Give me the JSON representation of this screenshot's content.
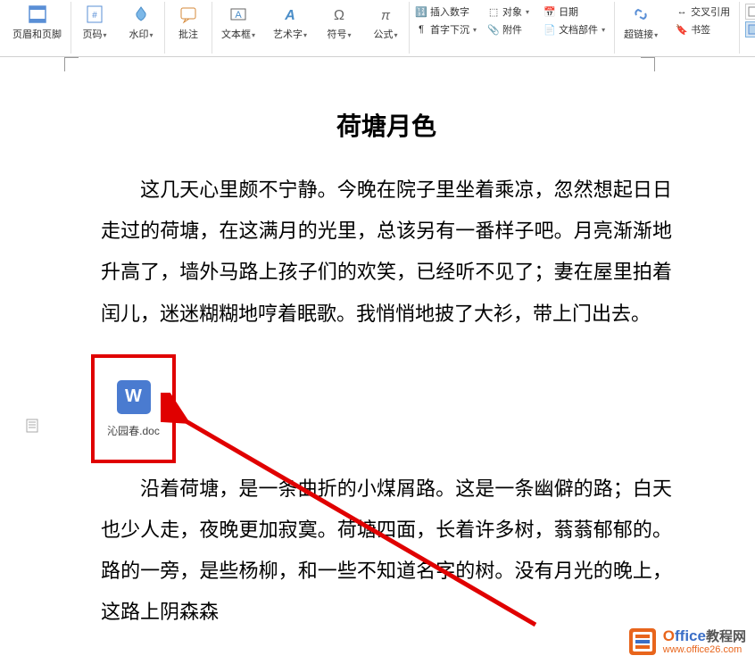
{
  "ribbon": {
    "header_footer": "页眉和页脚",
    "page_number": "页码",
    "watermark": "水印",
    "annotation": "批注",
    "textbox": "文本框",
    "wordart": "艺术字",
    "symbol": "符号",
    "equation": "公式",
    "insert_number": "插入数字",
    "object": "对象",
    "date": "日期",
    "drop_cap": "首字下沉",
    "attachment": "附件",
    "doc_parts": "文档部件",
    "hyperlink": "超链接",
    "cross_ref": "交叉引用",
    "bookmark": "书签"
  },
  "document": {
    "title": "荷塘月色",
    "para1": "这几天心里颇不宁静。今晚在院子里坐着乘凉，忽然想起日日走过的荷塘，在这满月的光里，总该另有一番样子吧。月亮渐渐地升高了，墙外马路上孩子们的欢笑，已经听不见了；妻在屋里拍着闰儿，迷迷糊糊地哼着眠歌。我悄悄地披了大衫，带上门出去。",
    "para2": "沿着荷塘，是一条曲折的小煤屑路。这是一条幽僻的路；白天也少人走，夜晚更加寂寞。荷塘四面，长着许多树，蓊蓊郁郁的。路的一旁，是些杨柳，和一些不知道名字的树。没有月光的晚上，这路上阴森森"
  },
  "embedded": {
    "icon_letter": "W",
    "filename": "沁园春.doc"
  },
  "watermark_brand": {
    "main_o": "O",
    "main_ffice": "ffice",
    "main_cn": "教程网",
    "sub": "www.office26.com"
  }
}
